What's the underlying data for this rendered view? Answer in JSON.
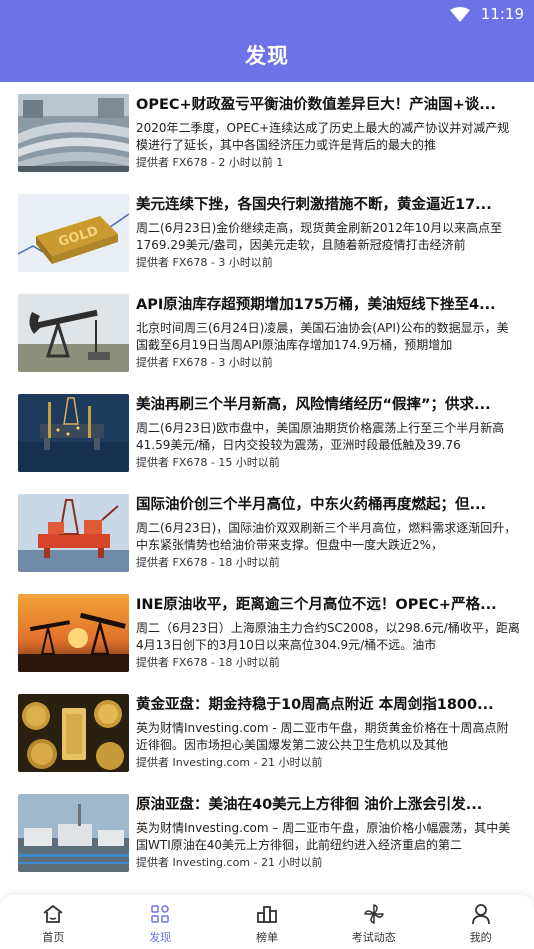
{
  "status": {
    "time": "11:19"
  },
  "header": {
    "title": "发现"
  },
  "colors": {
    "accent": "#6e72e8"
  },
  "feed": [
    {
      "headline": "OPEC+财政盈亏平衡油价数值差异巨大！产油国+谈...",
      "summary": "2020年二季度，OPEC+连续达成了历史上最大的减产协议并对减产规模进行了延长，其中各国经济压力或许是背后的最大的推",
      "meta": "提供者 FX678 - 2 小时以前 1",
      "image": "refinery-pipes"
    },
    {
      "headline": "美元连续下挫，各国央行刺激措施不断，黄金逼近17...",
      "summary": "周二(6月23日)金价继续走高，现货黄金刷新2012年10月以来高点至1769.29美元/盎司，因美元走软，且随着新冠疫情打击经济前",
      "meta": "提供者 FX678 - 3 小时以前",
      "image": "gold-bar"
    },
    {
      "headline": "API原油库存超预期增加175万桶，美油短线下挫至4...",
      "summary": "北京时间周三(6月24日)凌晨，美国石油协会(API)公布的数据显示，美国截至6月19日当周API原油库存增加174.9万桶，预期增加",
      "meta": "提供者 FX678 - 3 小时以前",
      "image": "pumpjack"
    },
    {
      "headline": "美油再刷三个半月新高，风险情绪经历“假摔”；供求...",
      "summary": "周二(6月23日)欧市盘中，美国原油期货价格震荡上行至三个半月新高41.59美元/桶，日内交投较为震荡，亚洲时段最低触及39.76",
      "meta": "提供者 FX678 - 15 小时以前",
      "image": "offshore-rig-night"
    },
    {
      "headline": "国际油价创三个半月高位，中东火药桶再度燃起；但...",
      "summary": "周二(6月23日)，国际油价双双刷新三个半月高位，燃料需求逐渐回升，中东紧张情势也给油价带来支撑。但盘中一度大跌近2%，",
      "meta": "提供者 FX678 - 18 小时以前",
      "image": "offshore-rig-day"
    },
    {
      "headline": "INE原油收平，距离逾三个月高位不远！OPEC+严格...",
      "summary": "周二（6月23日）上海原油主力合约SC2008，以298.6元/桶收平，距离4月13日创下的3月10日以来高位304.9元/桶不远。油市",
      "meta": "提供者 FX678 - 18 小时以前",
      "image": "pumpjack-sunset"
    },
    {
      "headline": "黄金亚盘：期金持稳于10周高点附近 本周剑指1800...",
      "summary": "英为财情Investing.com - 周二亚市午盘，期货黄金价格在十周高点附近徘徊。因市场担心美国爆发第二波公共卫生危机以及其他",
      "meta": "提供者 Investing.com - 21 小时以前",
      "image": "gold-coins"
    },
    {
      "headline": "原油亚盘：美油在40美元上方徘徊 油价上涨会引发...",
      "summary": "英为财情Investing.com – 周二亚市午盘，原油价格小幅震荡，其中美国WTI原油在40美元上方徘徊，此前纽约进入经济重启的第二",
      "meta": "提供者 Investing.com - 21 小时以前",
      "image": "oil-tanks"
    }
  ],
  "nav": [
    {
      "label": "首页",
      "icon": "home-icon"
    },
    {
      "label": "发现",
      "icon": "discover-icon"
    },
    {
      "label": "榜单",
      "icon": "ranking-icon"
    },
    {
      "label": "考试动态",
      "icon": "pinwheel-icon"
    },
    {
      "label": "我的",
      "icon": "profile-icon"
    }
  ]
}
